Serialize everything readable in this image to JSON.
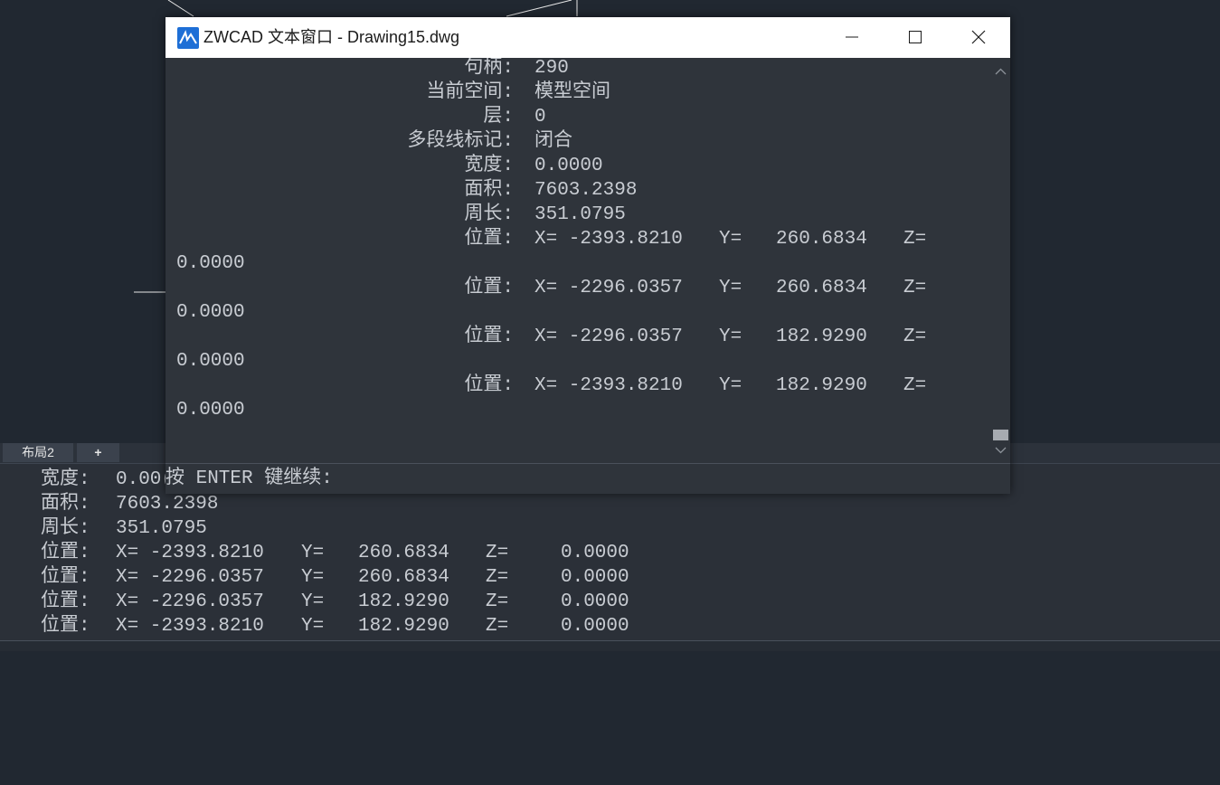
{
  "colors": {
    "background": "#212831",
    "text_window_bg": "#2f343b",
    "text": "#c8ccd2",
    "titlebar_bg": "#ffffff",
    "accent": "#1e6fd6"
  },
  "window": {
    "title": "ZWCAD 文本窗口 - Drawing15.dwg",
    "icon": "zwcad-app-icon",
    "buttons": {
      "minimize": "minimize-icon",
      "maximize": "maximize-icon",
      "close": "close-icon"
    },
    "properties": [
      {
        "label": "句柄:",
        "value": "290"
      },
      {
        "label": "当前空间:",
        "value": "模型空间"
      },
      {
        "label": "层:",
        "value": "0"
      },
      {
        "label": "多段线标记:",
        "value": "闭合"
      },
      {
        "label": "宽度:",
        "value": "0.0000"
      },
      {
        "label": "面积:",
        "value": "7603.2398"
      },
      {
        "label": "周长:",
        "value": "351.0795"
      }
    ],
    "positions": [
      {
        "label": "位置:",
        "x": "X= -2393.8210",
        "y": "Y=   260.6834",
        "z": "Z=",
        "z_value": "0.0000"
      },
      {
        "label": "位置:",
        "x": "X= -2296.0357",
        "y": "Y=   260.6834",
        "z": "Z=",
        "z_value": "0.0000"
      },
      {
        "label": "位置:",
        "x": "X= -2296.0357",
        "y": "Y=   182.9290",
        "z": "Z=",
        "z_value": "0.0000"
      },
      {
        "label": "位置:",
        "x": "X= -2393.8210",
        "y": "Y=   182.9290",
        "z": "Z=",
        "z_value": "0.0000"
      }
    ],
    "prompt": "按 ENTER 键继续:"
  },
  "tabs": [
    {
      "label": "布局2"
    },
    {
      "label": "+"
    }
  ],
  "command_history": {
    "width": {
      "label": "宽度:",
      "value": "0.00("
    },
    "area": {
      "label": "面积:",
      "value": "7603.2398"
    },
    "perimeter": {
      "label": "周长:",
      "value": "351.0795"
    },
    "positions": [
      {
        "label": "位置:",
        "x": "X= -2393.8210",
        "y": "Y=   260.6834",
        "z": "Z=",
        "z_value": "0.0000"
      },
      {
        "label": "位置:",
        "x": "X= -2296.0357",
        "y": "Y=   260.6834",
        "z": "Z=",
        "z_value": "0.0000"
      },
      {
        "label": "位置:",
        "x": "X= -2296.0357",
        "y": "Y=   182.9290",
        "z": "Z=",
        "z_value": "0.0000"
      },
      {
        "label": "位置:",
        "x": "X= -2393.8210",
        "y": "Y=   182.9290",
        "z": "Z=",
        "z_value": "0.0000"
      }
    ]
  }
}
